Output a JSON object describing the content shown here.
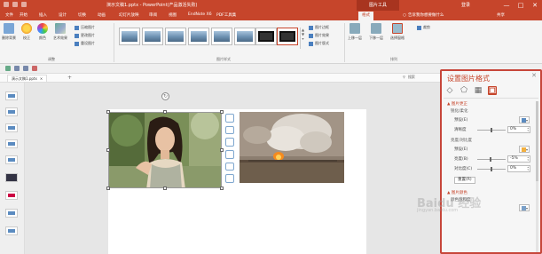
{
  "titlebar": {
    "title": "演示文稿1.pptx - PowerPoint(产品激活失败)",
    "context_tab": "图片工具",
    "login": "登录",
    "min": "—",
    "max": "□",
    "close": "✕"
  },
  "tabs": [
    {
      "label": "文件"
    },
    {
      "label": "开始"
    },
    {
      "label": "插入"
    },
    {
      "label": "设计"
    },
    {
      "label": "切换"
    },
    {
      "label": "动画"
    },
    {
      "label": "幻灯片放映"
    },
    {
      "label": "审阅"
    },
    {
      "label": "视图"
    },
    {
      "label": "EndNote X6"
    },
    {
      "label": "PDF工具集"
    },
    {
      "label": "格式",
      "active": true
    }
  ],
  "tell_me": "告诉我你想要做什么",
  "share": "共享",
  "ribbon": {
    "remove_bg": "删除背景",
    "corrections": "校正",
    "color": "颜色",
    "artistic": "艺术效果",
    "compress": "压缩图片",
    "change": "更改图片",
    "reset": "重设图片",
    "adjust_label": "调整",
    "style_label": "图片样式",
    "border": "图片边框",
    "effects": "图片效果",
    "layout": "图片版式",
    "bring_forward": "上移一层",
    "send_backward": "下移一层",
    "selection_pane": "选择窗格",
    "arrange_label": "排列",
    "crop": "裁剪",
    "size_label": "大小"
  },
  "file_tab": {
    "name": "演示文稿1.pptx",
    "search": "搜索"
  },
  "pane": {
    "title": "设置图片格式",
    "close": "✕",
    "section_corrections": "▲ 图片更正",
    "sharpen_heading": "锐化/柔化",
    "preset_label": "预设(E)",
    "sharpness_label": "清晰度",
    "sharpness_value": "0%",
    "brightness_heading": "亮度/对比度",
    "preset2_label": "预设(E)",
    "brightness_label": "亮度(B)",
    "brightness_value": "-5%",
    "contrast_label": "对比度(C)",
    "contrast_value": "0%",
    "reset_button": "重置(R)",
    "section_color": "▲ 图片颜色",
    "saturation_heading": "颜色饱和度"
  },
  "watermark": {
    "brand": "Baidu 经验",
    "url": "jingyan.baidu.com"
  },
  "colors": {
    "accent": "#c6452b",
    "pane_border": "#c7463a"
  },
  "icons": [
    "fill-line-icon",
    "effects-icon",
    "size-properties-icon",
    "picture-icon"
  ]
}
